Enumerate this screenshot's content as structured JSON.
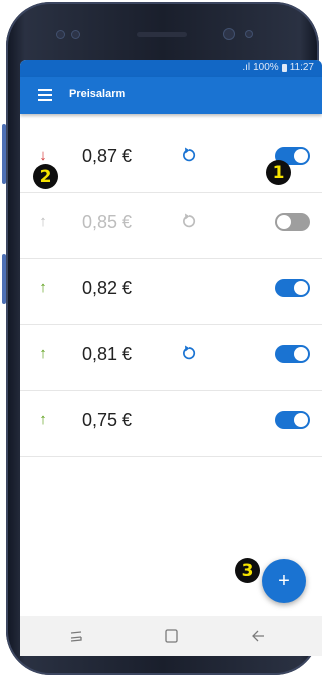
{
  "device": {
    "status_bar": {
      "signal_text": ".ıl",
      "battery": "100%",
      "time": "11:27"
    }
  },
  "app_bar": {
    "title": "Preisalarm",
    "menu_icon": "hamburger-menu-icon"
  },
  "alarms": [
    {
      "price": "0,87 €",
      "direction": "down",
      "arrow": "↓",
      "arrow_color": "#d32f2f",
      "repeat": true,
      "enabled": true
    },
    {
      "price": "0,85 €",
      "direction": "up",
      "arrow": "↑",
      "arrow_color": "#bdbdbd",
      "repeat": true,
      "enabled": false
    },
    {
      "price": "0,82 €",
      "direction": "up",
      "arrow": "↑",
      "arrow_color": "#5a9e16",
      "repeat": false,
      "enabled": true
    },
    {
      "price": "0,81 €",
      "direction": "up",
      "arrow": "↑",
      "arrow_color": "#5a9e16",
      "repeat": true,
      "enabled": true
    },
    {
      "price": "0,75 €",
      "direction": "up",
      "arrow": "↑",
      "arrow_color": "#5a9e16",
      "repeat": false,
      "enabled": true
    }
  ],
  "annotations": {
    "badge_1": "1",
    "badge_2": "2",
    "badge_3": "3"
  },
  "fab": {
    "label": "+",
    "icon": "add-icon"
  },
  "colors": {
    "primary": "#1a73d2",
    "status_bar": "#1267c5",
    "down_arrow": "#d32f2f",
    "up_arrow": "#5a9e16",
    "toggle_off": "#9e9e9e"
  }
}
